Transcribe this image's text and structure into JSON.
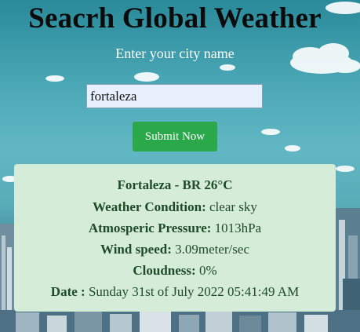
{
  "header": {
    "title": "Seacrh Global Weather",
    "subtitle": "Enter your city name"
  },
  "search": {
    "value": "fortaleza",
    "submit_label": "Submit Now"
  },
  "result": {
    "location": "Fortaleza - BR 26°C",
    "condition_label": "Weather Condition:",
    "condition_value": "clear sky",
    "pressure_label": "Atmosperic Pressure:",
    "pressure_value": "1013hPa",
    "wind_label": "Wind speed:",
    "wind_value": "3.09meter/sec",
    "cloudiness_label": "Cloudness:",
    "cloudiness_value": "0%",
    "date_label": "Date :",
    "date_value": "Sunday 31st of July 2022 05:41:49 AM"
  }
}
